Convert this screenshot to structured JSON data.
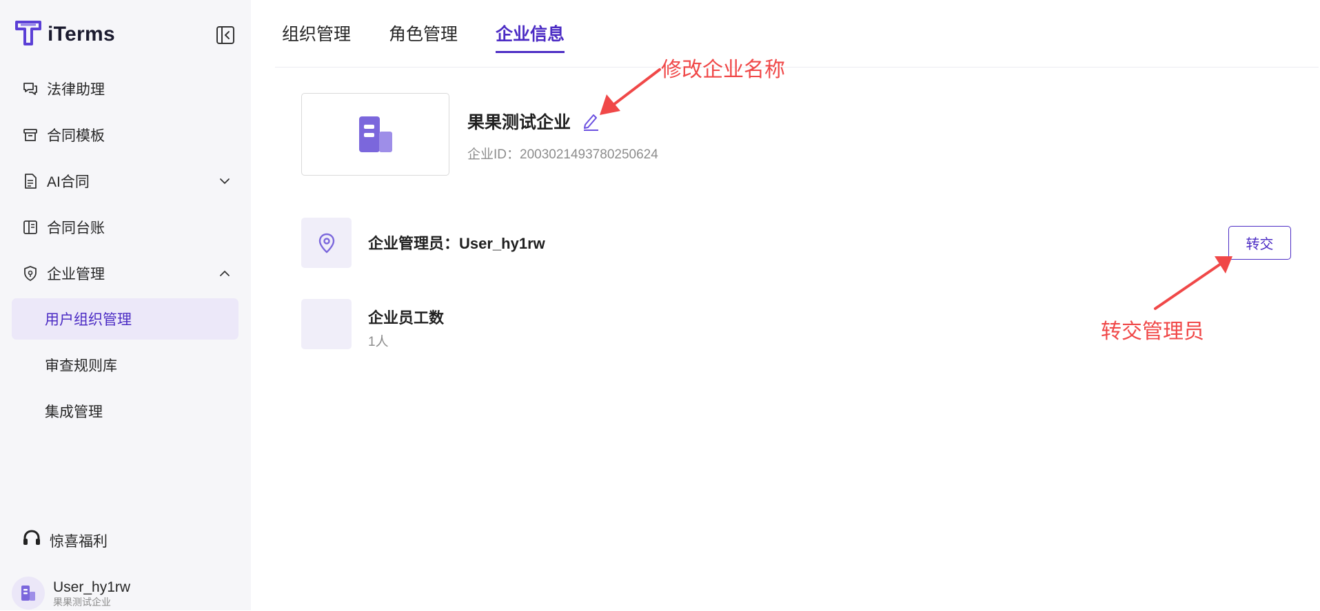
{
  "sidebar": {
    "logo_text": "iTerms",
    "items": [
      {
        "label": "法律助理",
        "icon": "chat-bubbles-icon"
      },
      {
        "label": "合同模板",
        "icon": "archive-box-icon"
      },
      {
        "label": "AI合同",
        "icon": "document-icon",
        "expand": "chevron-down-icon"
      },
      {
        "label": "合同台账",
        "icon": "ledger-book-icon"
      },
      {
        "label": "企业管理",
        "icon": "shield-icon",
        "expand": "chevron-up-icon"
      }
    ],
    "sub_items": [
      {
        "label": "用户组织管理",
        "active": true
      },
      {
        "label": "审查规则库",
        "active": false
      },
      {
        "label": "集成管理",
        "active": false
      }
    ],
    "bonus": {
      "label": "惊喜福利",
      "icon": "headset-icon"
    },
    "user": {
      "name": "User_hy1rw",
      "org": "果果测试企业"
    }
  },
  "tabs": [
    {
      "label": "组织管理",
      "active": false
    },
    {
      "label": "角色管理",
      "active": false
    },
    {
      "label": "企业信息",
      "active": true
    }
  ],
  "company": {
    "name": "果果测试企业",
    "id_label": "企业ID：",
    "id_value": "2003021493780250624",
    "admin_label": "企业管理员：",
    "admin_value": "User_hy1rw",
    "transfer_button": "转交",
    "employee_count_label": "企业员工数",
    "employee_count_value": "1人"
  },
  "annotations": {
    "rename": "修改企业名称",
    "transfer": "转交管理员"
  },
  "colors": {
    "accent": "#4b2bc4",
    "accent_icon": "#7b67dc",
    "active_bg": "#ece8f9",
    "annotation": "#f04848",
    "sidebar_bg": "#f6f6f9"
  }
}
